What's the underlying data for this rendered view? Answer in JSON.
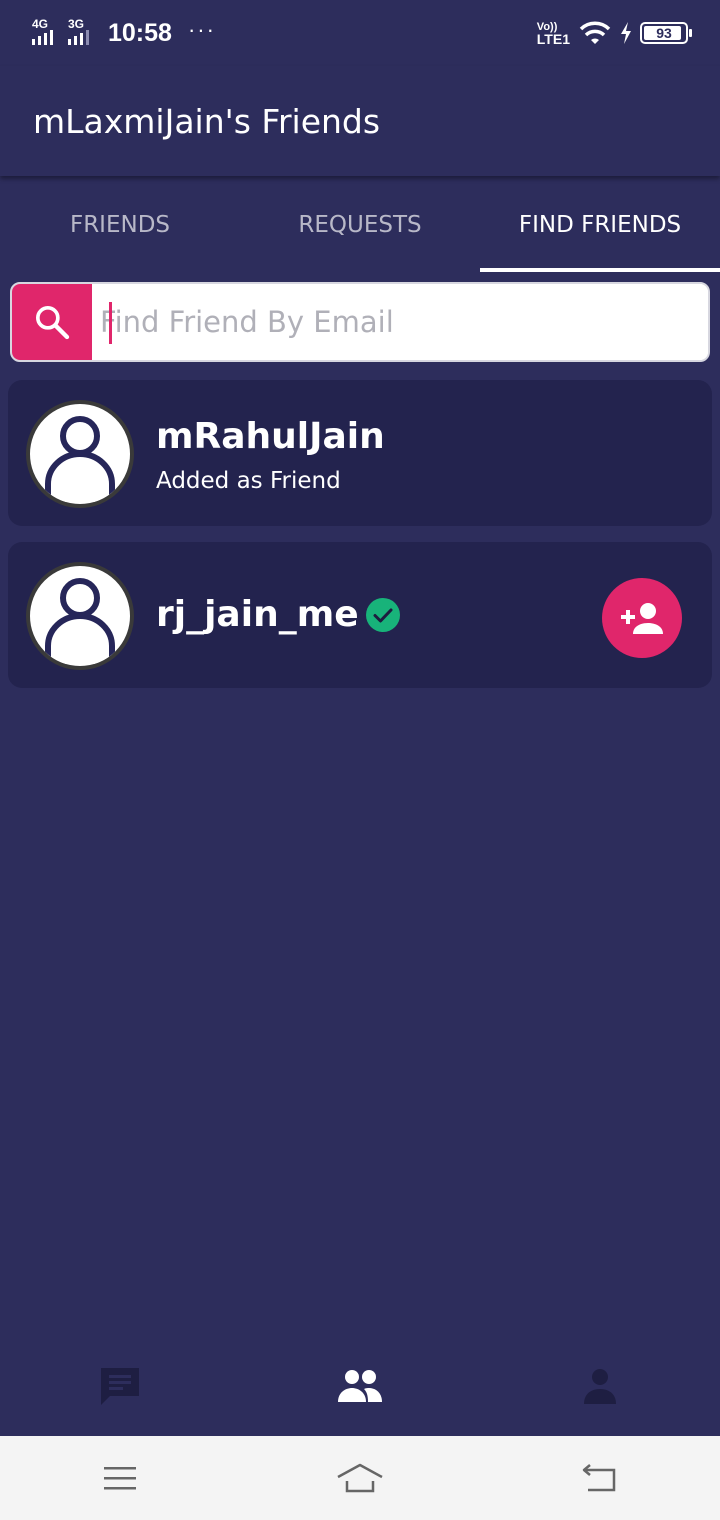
{
  "status_bar": {
    "network1": "4G",
    "network2": "3G",
    "time": "10:58",
    "more": "···",
    "volte_top": "Vo))",
    "volte_bottom": "LTE1",
    "battery_level": "93"
  },
  "app_bar": {
    "title": "mLaxmiJain's Friends"
  },
  "tabs": [
    {
      "label": "FRIENDS",
      "active": false
    },
    {
      "label": "REQUESTS",
      "active": false
    },
    {
      "label": "FIND FRIENDS",
      "active": true
    }
  ],
  "search": {
    "placeholder": "Find Friend By Email",
    "value": "",
    "icon": "search-icon"
  },
  "results": [
    {
      "name": "mRahulJain",
      "status": "Added as Friend",
      "verified": false,
      "can_add": false
    },
    {
      "name": "rj_jain_me",
      "status": "",
      "verified": true,
      "can_add": true
    }
  ],
  "bottom_nav": [
    {
      "icon": "chat-icon",
      "active": false
    },
    {
      "icon": "friends-icon",
      "active": true
    },
    {
      "icon": "profile-icon",
      "active": false
    }
  ],
  "system_nav": [
    {
      "icon": "menu-icon"
    },
    {
      "icon": "home-icon"
    },
    {
      "icon": "back-icon"
    }
  ],
  "colors": {
    "background": "#2d2d5c",
    "card": "#23234e",
    "accent": "#e0266b",
    "verified": "#18b37a"
  }
}
